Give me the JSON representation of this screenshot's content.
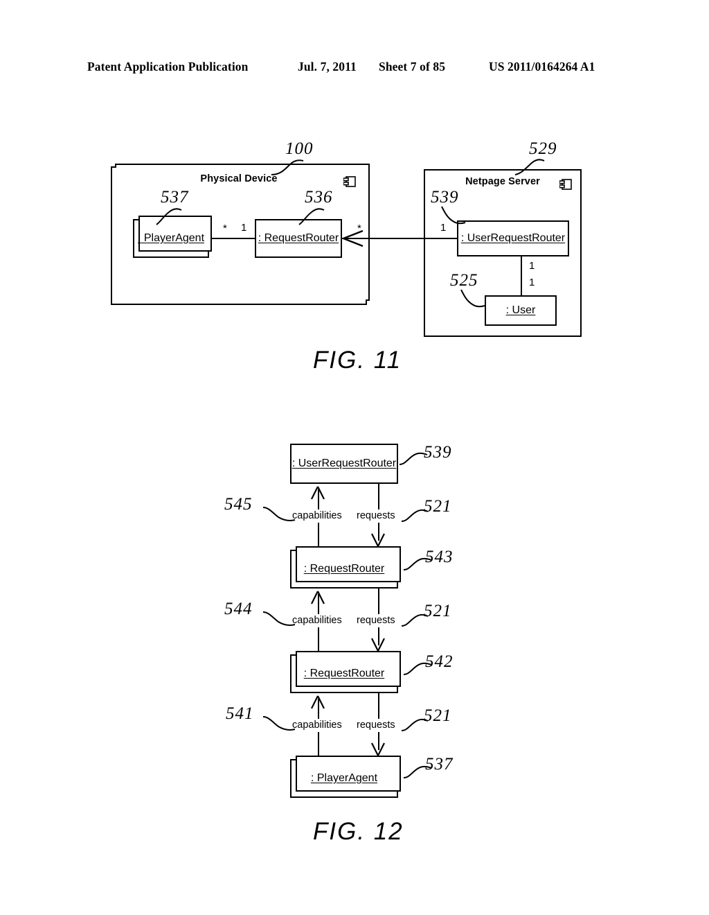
{
  "header": {
    "publication": "Patent Application Publication",
    "date": "Jul. 7, 2011",
    "sheet": "Sheet 7 of 85",
    "patent_number": "US 2011/0164264 A1"
  },
  "figures": [
    {
      "caption": "FIG. 11",
      "packages": [
        {
          "title": "Physical Device",
          "ref": "100",
          "component_icon": "uml-component-icon"
        },
        {
          "title": "Netpage Server",
          "ref": "529",
          "component_icon": "uml-component-icon"
        }
      ],
      "objects": [
        {
          "name": ": PlayerAgent",
          "ref": "537",
          "stacked": true
        },
        {
          "name": ": RequestRouter",
          "ref": "536",
          "stacked": false
        },
        {
          "name": ": UserRequestRouter",
          "ref": "539",
          "stacked": false
        },
        {
          "name": ": User",
          "ref": "525",
          "stacked": false
        }
      ],
      "multiplicities": [
        {
          "value": "*",
          "near": "player-agent-right"
        },
        {
          "value": "1",
          "near": "request-router-left"
        },
        {
          "value": "*",
          "near": "request-router-right"
        },
        {
          "value": "1",
          "near": "user-request-router-left"
        },
        {
          "value": "1",
          "near": "user-request-router-bottom"
        },
        {
          "value": "1",
          "near": "user-top"
        }
      ]
    },
    {
      "caption": "FIG. 12",
      "objects": [
        {
          "name": ": UserRequestRouter",
          "ref": "539",
          "stacked": false
        },
        {
          "name": ": RequestRouter",
          "ref": "543",
          "stacked": true
        },
        {
          "name": ": RequestRouter",
          "ref": "542",
          "stacked": true
        },
        {
          "name": ": PlayerAgent",
          "ref": "537",
          "stacked": true
        }
      ],
      "flows": [
        {
          "label": "capabilities",
          "ref": "545",
          "direction": "up"
        },
        {
          "label": "requests",
          "ref": "521",
          "direction": "down"
        },
        {
          "label": "capabilities",
          "ref": "544",
          "direction": "up"
        },
        {
          "label": "requests",
          "ref": "521",
          "direction": "down"
        },
        {
          "label": "capabilities",
          "ref": "541",
          "direction": "up"
        },
        {
          "label": "requests",
          "ref": "521",
          "direction": "down"
        }
      ]
    }
  ],
  "colors": {
    "ink": "#000000",
    "paper": "#ffffff"
  }
}
